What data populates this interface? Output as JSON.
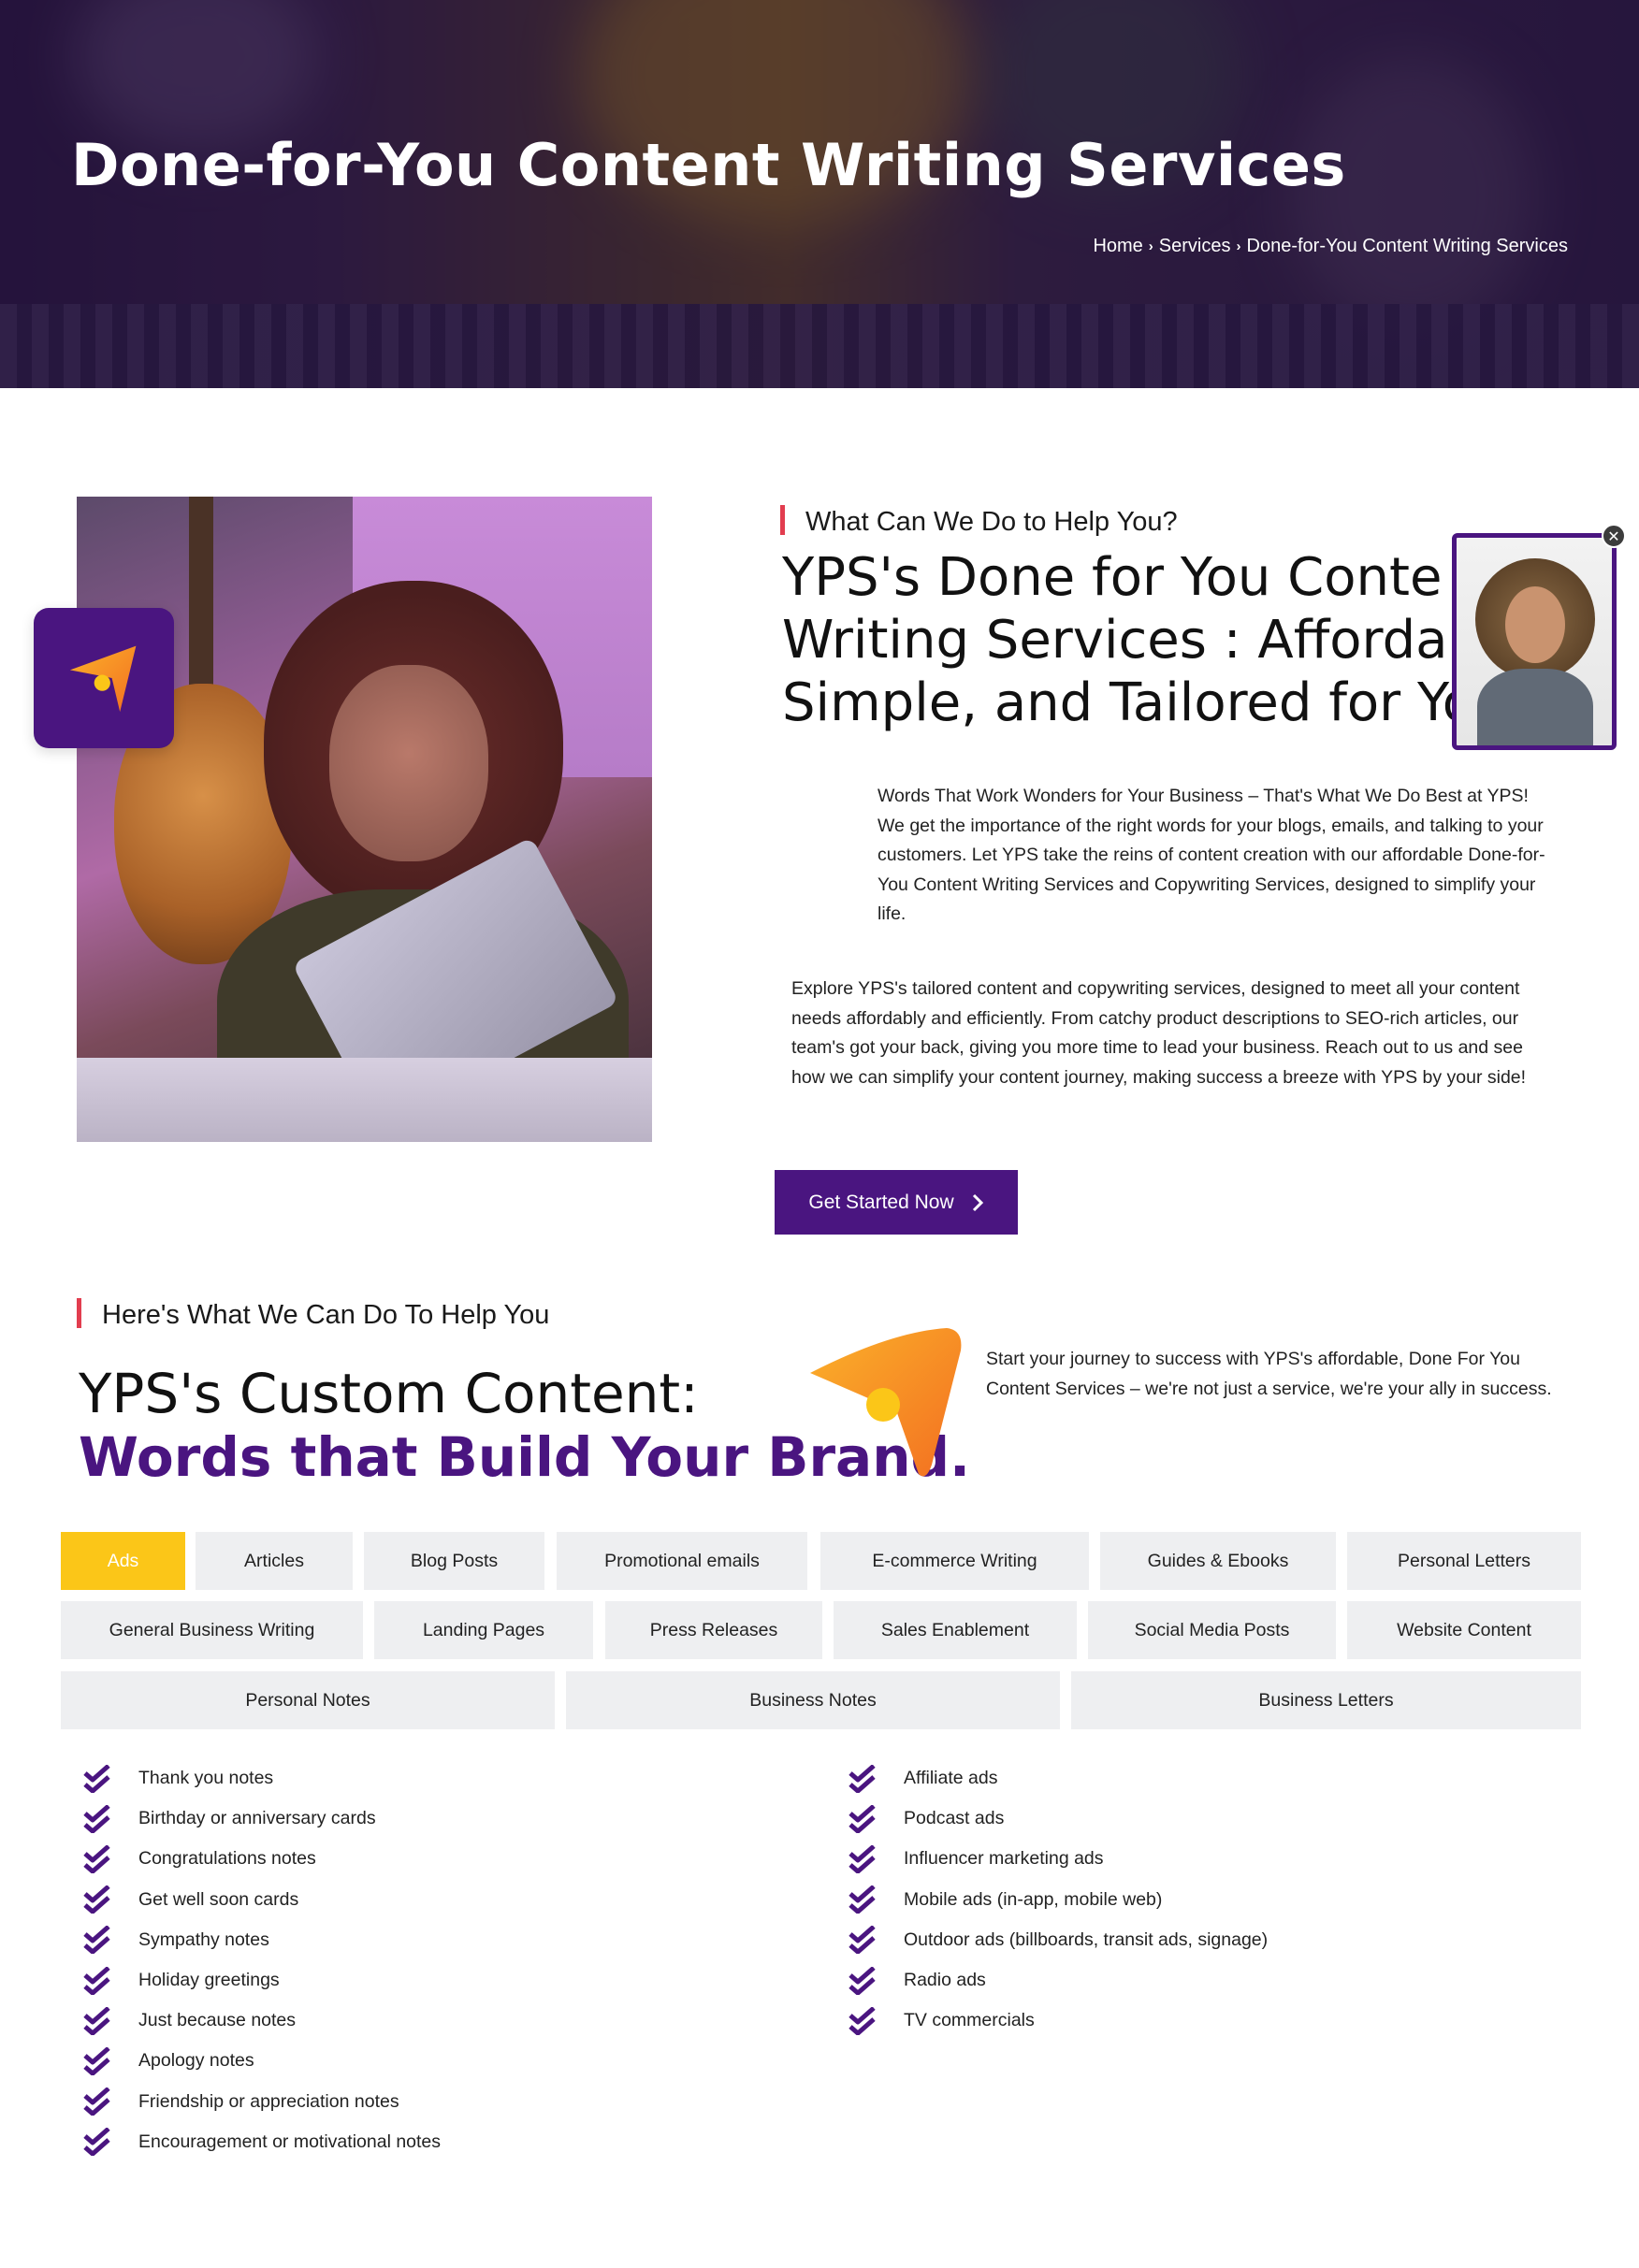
{
  "hero": {
    "title": "Done-for-You Content Writing Services",
    "breadcrumb": {
      "home": "Home",
      "separator": "›",
      "services": "Services",
      "current": "Done-for-You Content Writing Services"
    }
  },
  "intro": {
    "eyebrow": "What Can We Do to Help You?",
    "headline_lines": [
      "YPS's Done for You Conte",
      "Writing Services : Afforda",
      "Simple, and Tailored for Yo"
    ],
    "paragraph1": "Words That Work Wonders for Your Business – That's What We Do Best at YPS! We get the importance of the right words for your blogs, emails, and talking to your customers. Let YPS take the reins of content creation with our affordable Done-for-You Content Writing Services and Copywriting Services, designed to simplify your life.",
    "paragraph2": "Explore YPS's tailored content and copywriting services, designed to meet all your content needs affordably and efficiently. From catchy product descriptions to SEO-rich articles, our team's got your back, giving you more time to lead your business. Reach out to us and see how we can simplify your content journey, making success a breeze with YPS by your side!",
    "cta_label": "Get Started Now",
    "cta_icon": "chevron-right-icon"
  },
  "video_widget": {
    "close_symbol": "✕"
  },
  "services": {
    "eyebrow": "Here's What We Can Do To Help You",
    "headline_line1": "YPS's Custom Content:",
    "headline_line2": "Words that Build Your Brand.",
    "paragraph": "Start your journey to success with YPS's affordable, Done For You Content Services – we're not just a service, we're your ally in success.",
    "tabs_row1": [
      "Ads",
      "Articles",
      "Blog Posts",
      "Promotional emails",
      "E-commerce Writing",
      "Guides & Ebooks",
      "Personal Letters"
    ],
    "tabs_row2": [
      "General Business Writing",
      "Landing Pages",
      "Press Releases",
      "Sales Enablement",
      "Social Media Posts",
      "Website Content"
    ],
    "tabs_row3": [
      "Personal Notes",
      "Business Notes",
      "Business Letters"
    ],
    "active_tab": "Ads",
    "list_left": [
      "Thank you notes",
      "Birthday or anniversary cards",
      "Congratulations notes",
      "Get well soon cards",
      "Sympathy notes",
      "Holiday greetings",
      "Just because notes",
      "Apology notes",
      "Friendship or appreciation notes",
      "Encouragement or motivational notes"
    ],
    "list_right": [
      "Affiliate ads",
      "Podcast ads",
      "Influencer marketing ads",
      "Mobile ads (in-app, mobile web)",
      "Outdoor ads (billboards, transit ads, signage)",
      "Radio ads",
      "TV commercials"
    ]
  },
  "colors": {
    "brand_purple": "#4a1580",
    "accent_yellow": "#fbc618",
    "accent_red": "#e23d4f",
    "tab_bg": "#eeeff1"
  }
}
